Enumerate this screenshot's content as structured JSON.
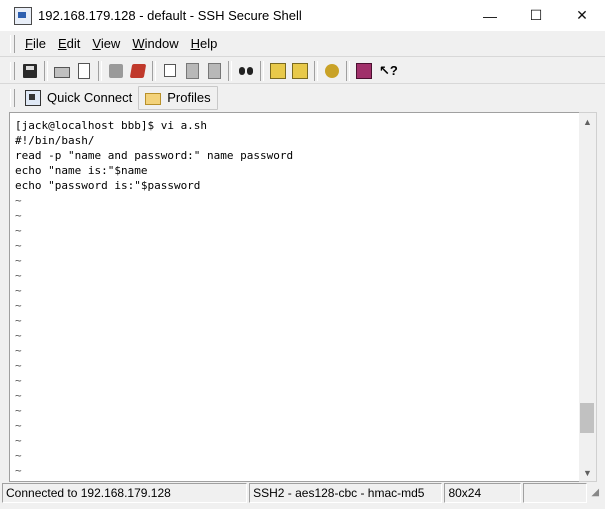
{
  "window": {
    "title": "192.168.179.128 - default - SSH Secure Shell",
    "controls": {
      "minimize": "—",
      "maximize": "☐",
      "close": "✕"
    }
  },
  "menu": {
    "items": [
      {
        "u": "F",
        "rest": "ile"
      },
      {
        "u": "E",
        "rest": "dit"
      },
      {
        "u": "V",
        "rest": "iew"
      },
      {
        "u": "W",
        "rest": "indow"
      },
      {
        "u": "H",
        "rest": "elp"
      }
    ]
  },
  "quickbar": {
    "quick_connect": "Quick Connect",
    "profiles": "Profiles"
  },
  "terminal": {
    "lines": [
      "[jack@localhost bbb]$ vi a.sh",
      "#!/bin/bash/",
      "read -p \"name and password:\" name password",
      "echo \"name is:\"$name",
      "echo \"password is:\"$password"
    ],
    "tilde": "~"
  },
  "status": {
    "connection": "Connected to 192.168.179.128",
    "cipher": "SSH2 - aes128-cbc - hmac-md5",
    "size": "80x24"
  }
}
